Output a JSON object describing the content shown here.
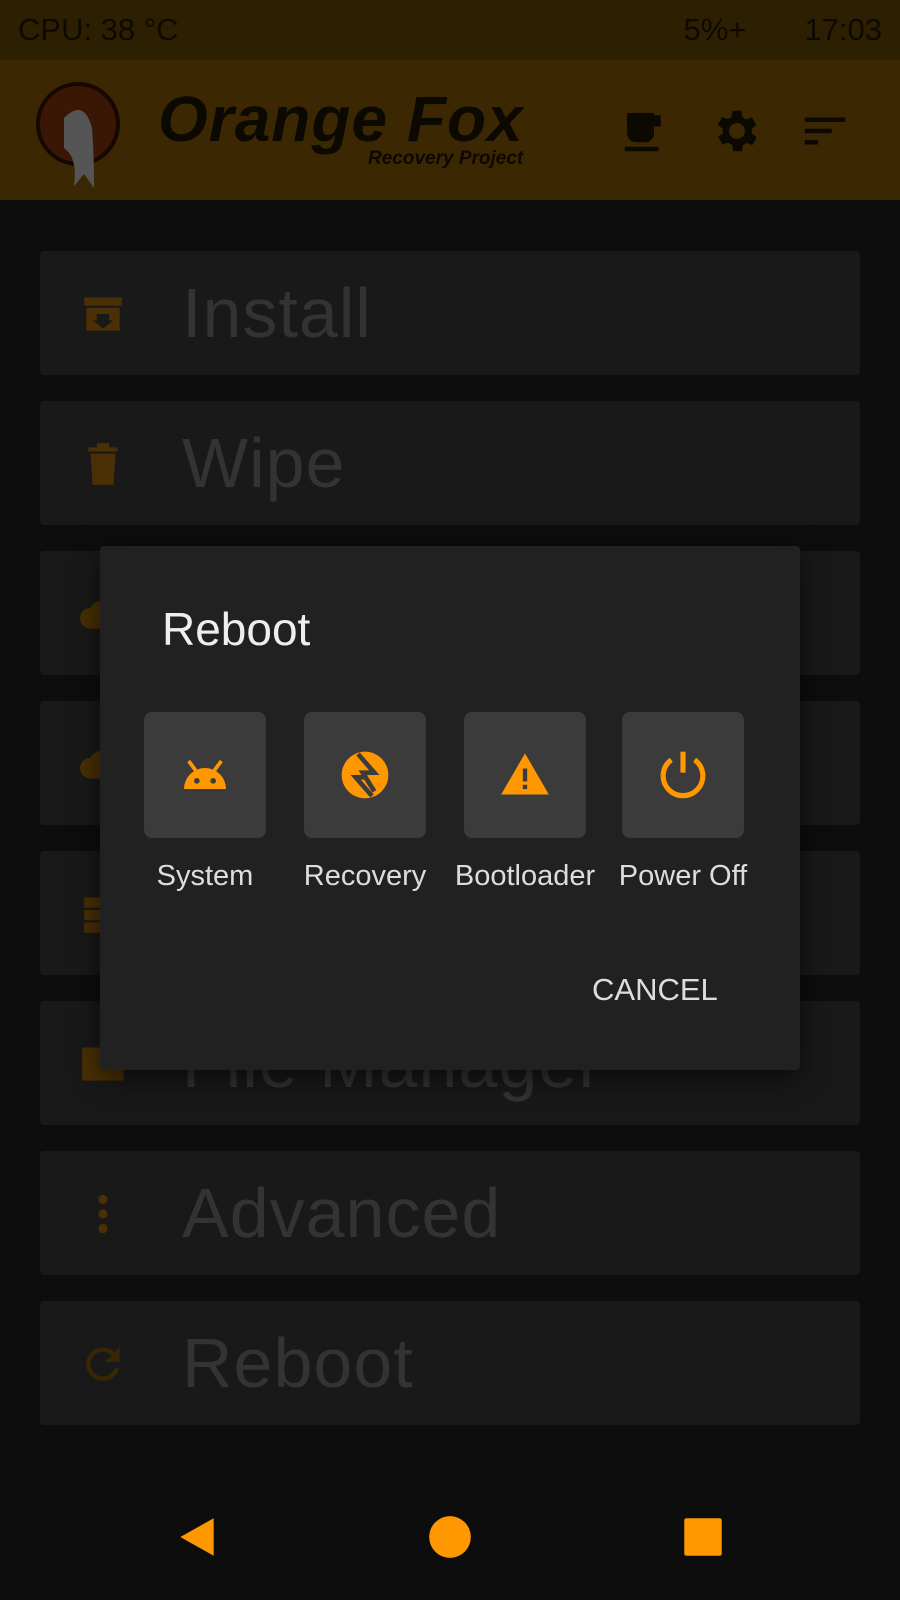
{
  "status_bar": {
    "cpu": "CPU: 38 °C",
    "battery": "5%+",
    "time": "17:03"
  },
  "header": {
    "title": "Orange Fox",
    "subtitle": "Recovery Project",
    "icons": [
      "fox-logo",
      "coffee-icon",
      "gear-icon",
      "sort-menu-icon"
    ]
  },
  "menu": {
    "items": [
      {
        "label": "Install",
        "icon": "install-box-icon"
      },
      {
        "label": "Wipe",
        "icon": "trash-icon"
      },
      {
        "label": "",
        "icon": "cloud-upload-icon"
      },
      {
        "label": "",
        "icon": "cloud-download-icon"
      },
      {
        "label": "",
        "icon": "partitions-icon"
      },
      {
        "label": "File Manager",
        "icon": "folder-icon"
      },
      {
        "label": "Advanced",
        "icon": "dots-vertical-icon"
      },
      {
        "label": "Reboot",
        "icon": "refresh-icon"
      }
    ]
  },
  "dialog": {
    "title": "Reboot",
    "options": [
      {
        "label": "System",
        "icon": "android-icon"
      },
      {
        "label": "Recovery",
        "icon": "twrp-recovery-icon"
      },
      {
        "label": "Bootloader",
        "icon": "warning-icon"
      },
      {
        "label": "Power Off",
        "icon": "power-icon"
      }
    ],
    "cancel": "CANCEL"
  },
  "nav": {
    "icons": [
      "back-icon",
      "home-icon",
      "recents-icon"
    ]
  },
  "colors": {
    "accent": "#ff9800",
    "dialog_bg": "#212121",
    "tile_bg": "#3b3b3b",
    "header_dimmed": "#3b2802"
  }
}
